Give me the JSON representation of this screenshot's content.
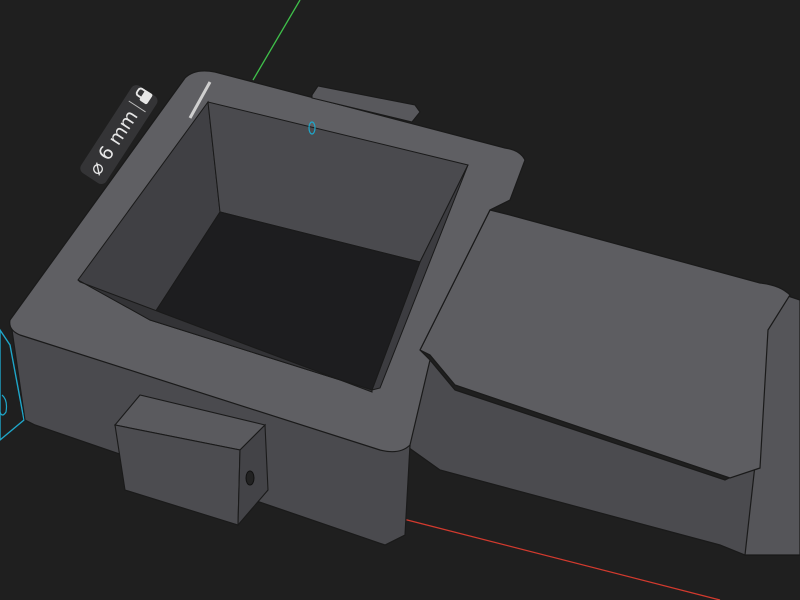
{
  "viewport": {
    "dimension_label": "⌀ 6 mm",
    "axis_colors": {
      "x": "#d23a2e",
      "y": "#3fbf4a",
      "selection": "#1fa6c9"
    },
    "model_colors": {
      "top": "#5c5c60",
      "side": "#4a4a4e",
      "inner": "#3a3a3e",
      "floor": "#1c1c1e",
      "edge": "#1a1a1a",
      "highlight": "#7a7a7e"
    },
    "lock_icon": "lock-icon"
  }
}
